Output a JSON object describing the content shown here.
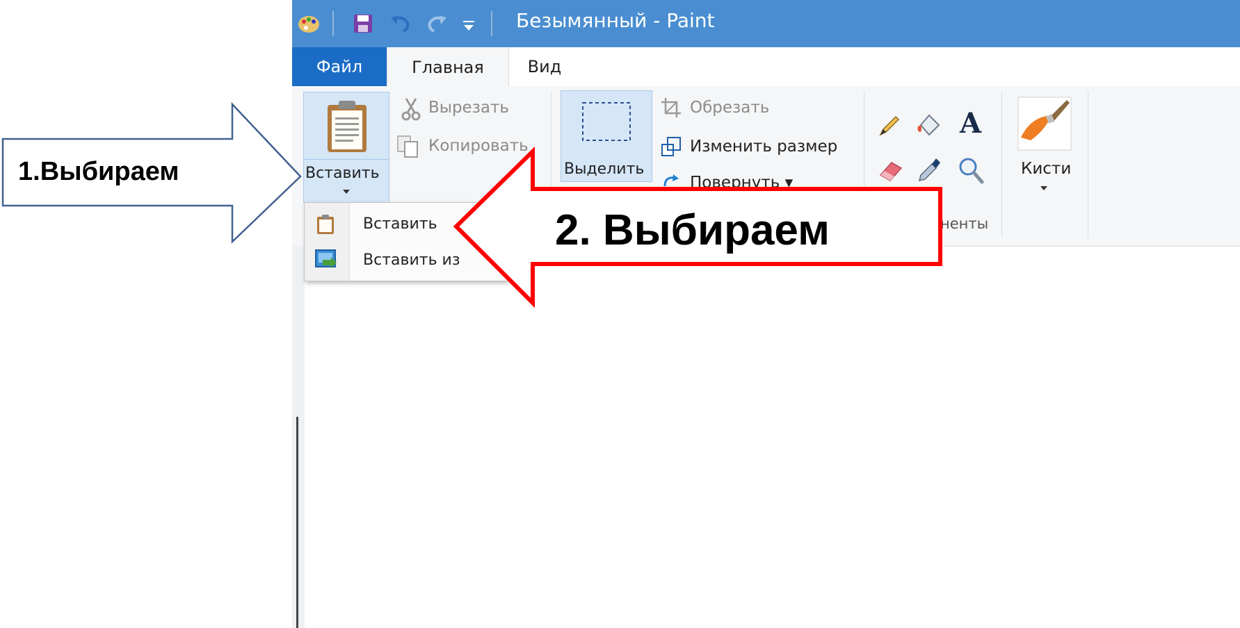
{
  "window": {
    "title": "Безымянный - Paint",
    "accent": "#4a8ed1",
    "file_tab_color": "#1b6cc6"
  },
  "tabs": {
    "file": "Файл",
    "home": "Главная",
    "view": "Вид"
  },
  "ribbon": {
    "clipboard": {
      "paste": "Вставить",
      "cut": "Вырезать",
      "copy": "Копировать"
    },
    "image": {
      "select": "Выделить",
      "crop": "Обрезать",
      "resize": "Изменить размер",
      "rotate": "Повернуть ▾"
    },
    "tools": {
      "group_label": "ненты"
    },
    "brushes": {
      "label": "Кисти"
    }
  },
  "paste_menu": {
    "items": [
      {
        "label": "Вставить",
        "icon": "clipboard-icon"
      },
      {
        "label": "Вставить из",
        "icon": "paste-from-icon"
      }
    ]
  },
  "callouts": {
    "step1": "1.Выбираем",
    "step2": "2. Выбираем",
    "step2_color": "#ff0000",
    "step1_color": "#41618f"
  }
}
